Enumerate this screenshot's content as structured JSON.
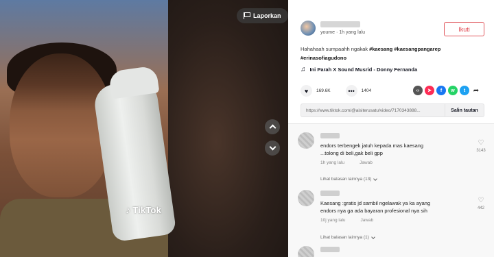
{
  "video": {
    "watermark": "TikTok",
    "report_label": "Laporkan"
  },
  "author": {
    "meta": "youme · 1h yang lalu",
    "follow_label": "Ikuti"
  },
  "caption": {
    "text": "Hahahaah sumpaahh ngakak ",
    "emoji": "",
    "tags": [
      "#kaesang",
      "#kaesangpangarep",
      "#erinasofiagudono"
    ]
  },
  "music": {
    "title": "Ini Parah X Sound Musrid - Donny Fernanda"
  },
  "stats": {
    "likes": "169.6K",
    "comments": "1404"
  },
  "share_icons": [
    {
      "name": "embed-icon",
      "glyph": "‹›",
      "color": "#555555"
    },
    {
      "name": "send-icon",
      "glyph": "➤",
      "color": "#fe2c55"
    },
    {
      "name": "facebook-icon",
      "glyph": "f",
      "color": "#1877f2"
    },
    {
      "name": "whatsapp-icon",
      "glyph": "w",
      "color": "#25d366"
    },
    {
      "name": "twitter-icon",
      "glyph": "t",
      "color": "#1da1f2"
    }
  ],
  "share_more_glyph": "➦",
  "link": {
    "url": "https://www.tiktok.com/@aisiterusatu/video/7170343888...",
    "copy_label": "Salin tautan"
  },
  "comments": [
    {
      "line1": "endors terbengek jatuh kepada mas kaesang",
      "line2": "...tolong di beli,gak beli gpp",
      "time": "1h yang lalu",
      "reply": "Jawab",
      "likes": "3143",
      "replies": "Lihat balasan lainnya (13)"
    },
    {
      "line1": "Kaesang :gratis jd sambil ngelawak ya ka ayang",
      "line2": "endors nya  ga ada bayaran profesional nya sih",
      "time": "10j yang lalu",
      "reply": "Jawab",
      "likes": "442",
      "replies": "Lihat balasan lainnya (1)"
    }
  ],
  "colors": {
    "accent": "#fe2c55",
    "follow_border": "#e0555b"
  }
}
